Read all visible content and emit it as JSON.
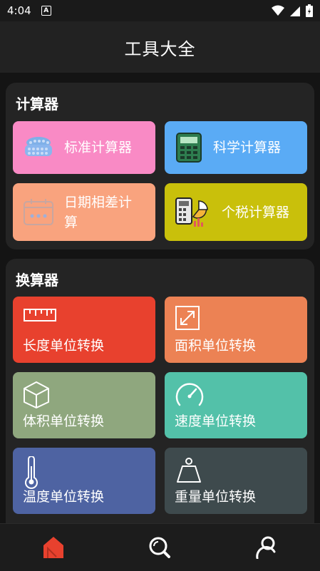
{
  "status": {
    "time": "4:04",
    "a_icon": "A"
  },
  "header": {
    "title": "工具大全"
  },
  "calculators": {
    "title": "计算器",
    "items": [
      {
        "label": "标准计算器",
        "icon": "abacus-icon",
        "color": "#F98AC5"
      },
      {
        "label": "科学计算器",
        "icon": "scientific-calculator-icon",
        "color": "#5AABF5"
      },
      {
        "label": "日期相差计算",
        "icon": "calendar-icon",
        "color": "#F9A37E"
      },
      {
        "label": "个税计算器",
        "icon": "tax-calculator-icon",
        "color": "#C9C00B"
      }
    ]
  },
  "converters": {
    "title": "换算器",
    "items": [
      {
        "label": "长度单位转换",
        "icon": "ruler-icon",
        "color": "#E8412E"
      },
      {
        "label": "面积单位转换",
        "icon": "area-arrows-icon",
        "color": "#EC8254"
      },
      {
        "label": "体积单位转换",
        "icon": "cube-icon",
        "color": "#8FA77E"
      },
      {
        "label": "速度单位转换",
        "icon": "speedometer-icon",
        "color": "#53C1A9"
      },
      {
        "label": "温度单位转换",
        "icon": "thermometer-icon",
        "color": "#4E63A2"
      },
      {
        "label": "重量单位转换",
        "icon": "weight-icon",
        "color": "#3E4A4D"
      }
    ]
  },
  "nav": {
    "items": [
      {
        "name": "home",
        "icon": "home-icon",
        "active_color": "#E8412E"
      },
      {
        "name": "search",
        "icon": "search-icon"
      },
      {
        "name": "profile",
        "icon": "user-icon"
      }
    ]
  }
}
